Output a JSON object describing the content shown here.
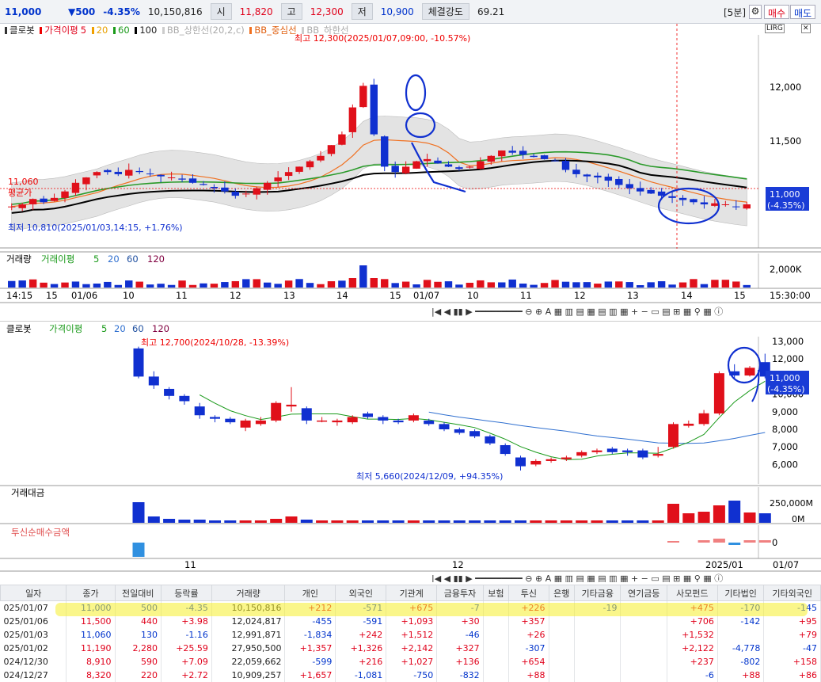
{
  "top": {
    "price": "11,000",
    "change": "▼500",
    "rate": "-4.35%",
    "volume": "10,150,816",
    "open_label": "시",
    "open": "11,820",
    "high_label": "고",
    "high": "12,300",
    "low_label": "저",
    "low": "10,900",
    "strength_label": "체결강도",
    "strength": "69.21",
    "period": "[5분]",
    "buy": "매수",
    "sell": "매도"
  },
  "chart1": {
    "legend": {
      "name": "클로봇",
      "ma": "가격이평",
      "ma_periods": [
        "5",
        "20",
        "60",
        "100"
      ],
      "bb": [
        "BB_상한선(20,2,c)",
        "BB_중심선",
        "BB_하한선"
      ]
    },
    "y_ticks": [
      "12,000",
      "11,500"
    ],
    "high_note": "최고 12,300(2025/01/07,09:00, -10.57%)",
    "low_note": "최저 10,810(2025/01/03,14:15, +1.76%)",
    "avg_label": "평균가",
    "avg_value": "11,060",
    "last_price": "11,000",
    "last_rate": "(-4.35%)",
    "vol_legend": {
      "name": "거래량",
      "ma": "거래이평",
      "periods": [
        "5",
        "20",
        "60",
        "120"
      ]
    },
    "vol_tick": "2,000K",
    "x_ticks": [
      "14:15",
      "15",
      "01/06",
      "10",
      "11",
      "12",
      "13",
      "14",
      "15",
      "01/07",
      "10",
      "11",
      "12",
      "13",
      "14",
      "15"
    ],
    "x_end": "15:30:00",
    "corner": "LIRG"
  },
  "chart2": {
    "legend": {
      "name": "클로봇",
      "ma": "가격이평",
      "periods": [
        "5",
        "20",
        "60",
        "120"
      ]
    },
    "y_ticks": [
      "13,000",
      "12,000",
      "11,000",
      "10,000",
      "9,000",
      "8,000",
      "7,000",
      "6,000"
    ],
    "high_note": "최고 12,700(2024/10/28, -13.39%)",
    "low_note": "최저 5,660(2024/12/09, +94.35%)",
    "last_price": "11,000",
    "last_rate": "(-4.35%)",
    "amount_label": "거래대금",
    "amount_tick": "250,000M",
    "amount_zero": "0M",
    "net_label": "투신순매수금액",
    "net_zero": "0",
    "x_ticks": [
      "11",
      "12",
      "2025/01"
    ],
    "x_end": "01/07"
  },
  "table": {
    "headers": [
      "일자",
      "종가",
      "전일대비",
      "등락률",
      "거래량",
      "개인",
      "외국인",
      "기관계",
      "금융투자",
      "보험",
      "투신",
      "은행",
      "기타금융",
      "연기금등",
      "사모펀드",
      "기타법인",
      "기타외국인"
    ],
    "rows": [
      [
        "025/01/07",
        "11,000",
        "500",
        "-4.35",
        "10,150,816",
        "+212",
        "-571",
        "+675",
        "-7",
        "",
        "+226",
        "",
        "-19",
        "",
        "+475",
        "-170",
        "-145"
      ],
      [
        "025/01/06",
        "11,500",
        "440",
        "+3.98",
        "12,024,817",
        "-455",
        "-591",
        "+1,093",
        "+30",
        "",
        "+357",
        "",
        "",
        "",
        "+706",
        "-142",
        "+95"
      ],
      [
        "025/01/03",
        "11,060",
        "130",
        "-1.16",
        "12,991,871",
        "-1,834",
        "+242",
        "+1,512",
        "-46",
        "",
        "+26",
        "",
        "",
        "",
        "+1,532",
        "",
        "+79"
      ],
      [
        "025/01/02",
        "11,190",
        "2,280",
        "+25.59",
        "27,950,500",
        "+1,357",
        "+1,326",
        "+2,142",
        "+327",
        "",
        "-307",
        "",
        "",
        "",
        "+2,122",
        "-4,778",
        "-47"
      ],
      [
        "024/12/30",
        "8,910",
        "590",
        "+7.09",
        "22,059,662",
        "-599",
        "+216",
        "+1,027",
        "+136",
        "",
        "+654",
        "",
        "",
        "",
        "+237",
        "-802",
        "+158"
      ],
      [
        "024/12/27",
        "8,320",
        "220",
        "+2.72",
        "10,909,257",
        "+1,657",
        "-1,081",
        "-750",
        "-832",
        "",
        "+88",
        "",
        "",
        "",
        "-6",
        "+88",
        "+86"
      ]
    ]
  }
}
